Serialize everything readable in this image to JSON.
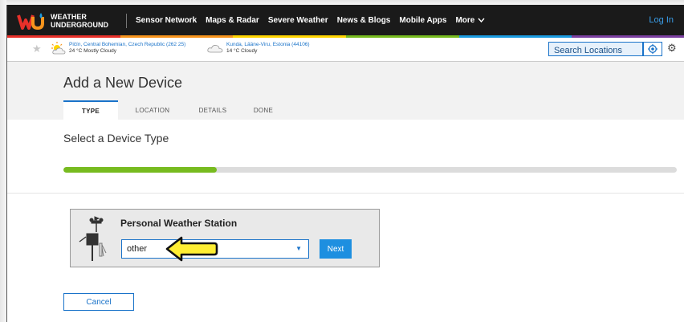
{
  "header": {
    "brand_line1": "WEATHER",
    "brand_line2": "UNDERGROUND",
    "nav": [
      "Sensor Network",
      "Maps & Radar",
      "Severe Weather",
      "News & Blogs",
      "Mobile Apps",
      "More"
    ],
    "login": "Log In",
    "stripe_colors": [
      "#e8302a",
      "#f7941d",
      "#ffd400",
      "#77bb1f",
      "#1a9be0",
      "#7b3fa0"
    ]
  },
  "locations": [
    {
      "place": "Pičín, Central Bohemian, Czech Republic (262 25)",
      "conditions": "24 °C Mostly Cloudy",
      "icon": "partly-cloudy-icon"
    },
    {
      "place": "Kunda, Lääne-Viru, Estonia (44106)",
      "conditions": "14 °C Cloudy",
      "icon": "cloudy-icon"
    }
  ],
  "search": {
    "placeholder": "Search Locations"
  },
  "page": {
    "title": "Add a New Device",
    "tabs": [
      "TYPE",
      "LOCATION",
      "DETAILS",
      "DONE"
    ],
    "active_tab": 0,
    "subtitle": "Select a Device Type",
    "progress": 0.25
  },
  "device": {
    "title": "Personal Weather Station",
    "selected": "other",
    "next_label": "Next"
  },
  "cancel_label": "Cancel",
  "colors": {
    "accent": "#1a73c9",
    "progress": "#77bb1f",
    "next_button": "#1e8fe0"
  }
}
